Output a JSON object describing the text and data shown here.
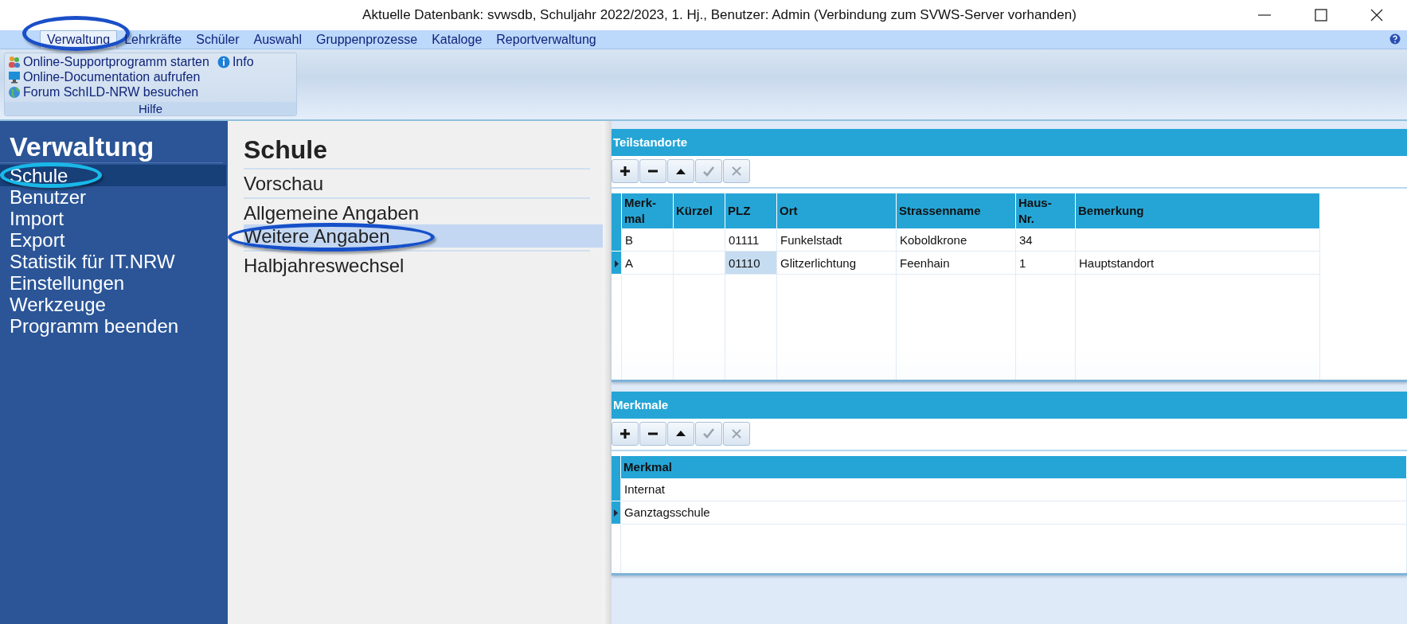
{
  "window": {
    "title": "Aktuelle Datenbank: svwsdb, Schuljahr 2022/2023, 1. Hj., Benutzer: Admin (Verbindung zum SVWS-Server vorhanden)"
  },
  "menu": [
    {
      "label": "Verwaltung",
      "selected": true,
      "circled": true
    },
    {
      "label": "Lehrkräfte",
      "selected": false
    },
    {
      "label": "Schüler",
      "selected": false
    },
    {
      "label": "Auswahl",
      "selected": false
    },
    {
      "label": "Gruppenprozesse",
      "selected": false
    },
    {
      "label": "Kataloge",
      "selected": false
    },
    {
      "label": "Reportverwaltung",
      "selected": false
    }
  ],
  "ribbon": {
    "group_label": "Hilfe",
    "items": [
      {
        "kind": "people",
        "label": "Online-Supportprogramm starten"
      },
      {
        "kind": "monitor",
        "label": "Online-Documentation aufrufen"
      },
      {
        "kind": "globe",
        "label": "Forum SchILD-NRW besuchen"
      }
    ],
    "info": {
      "kind": "info",
      "label": "Info"
    }
  },
  "sidebar": {
    "title": "Verwaltung",
    "items": [
      {
        "label": "Schule",
        "selected": true,
        "circled": true
      },
      {
        "label": "Benutzer",
        "selected": false
      },
      {
        "label": "Import",
        "selected": false
      },
      {
        "label": "Export",
        "selected": false
      },
      {
        "label": "Statistik für IT.NRW",
        "selected": false
      },
      {
        "label": "Einstellungen",
        "selected": false
      },
      {
        "label": "Werkzeuge",
        "selected": false
      },
      {
        "label": "Programm beenden",
        "selected": false
      }
    ]
  },
  "section": {
    "title": "Schule",
    "groups": [
      {
        "items": [
          {
            "label": "Vorschau",
            "selected": false
          }
        ]
      },
      {
        "items": [
          {
            "label": "Allgemeine Angaben",
            "selected": false
          },
          {
            "label": "Weitere Angaben",
            "selected": true,
            "circled": true
          }
        ]
      },
      {
        "items": [
          {
            "label": "Halbjahreswechsel",
            "selected": false
          }
        ]
      }
    ]
  },
  "panels": [
    {
      "title": "Teilstandorte",
      "tools": [
        {
          "kind": "add",
          "disabled": false
        },
        {
          "kind": "remove",
          "disabled": false
        },
        {
          "kind": "up",
          "disabled": false
        },
        {
          "kind": "save",
          "disabled": true
        },
        {
          "kind": "cancel",
          "disabled": true
        }
      ],
      "columns": [
        "Merk-\nmal",
        "Kürzel",
        "PLZ",
        "Ort",
        "Strassenname",
        "Haus-\nNr.",
        "Bemerkung"
      ],
      "rows": [
        {
          "current": false,
          "cells": [
            {
              "text": "B",
              "selected": false
            },
            {
              "selected": false
            },
            {
              "text": "01111",
              "selected": false
            },
            {
              "text": "Funkelstadt",
              "selected": false
            },
            {
              "text": "Koboldkrone",
              "selected": false
            },
            {
              "text": "34",
              "selected": false
            },
            {
              "selected": false
            }
          ]
        },
        {
          "current": true,
          "cells": [
            {
              "text": "A",
              "selected": false
            },
            {
              "selected": false
            },
            {
              "text": "01110",
              "selected": true
            },
            {
              "text": "Glitzerlichtung",
              "selected": false
            },
            {
              "text": "Feenhain",
              "selected": false
            },
            {
              "text": "1",
              "selected": false
            },
            {
              "text": "Hauptstandort",
              "selected": false
            }
          ]
        }
      ]
    },
    {
      "title": "Merkmale",
      "tools": [
        {
          "kind": "add",
          "disabled": false
        },
        {
          "kind": "remove",
          "disabled": false
        },
        {
          "kind": "up",
          "disabled": false
        },
        {
          "kind": "save",
          "disabled": true
        },
        {
          "kind": "cancel",
          "disabled": true
        }
      ],
      "columns": [
        "Merkmal"
      ],
      "rows": [
        {
          "current": false,
          "cells": [
            {
              "text": "Internat",
              "selected": false
            }
          ]
        },
        {
          "current": true,
          "cells": [
            {
              "text": "Ganztagsschule",
              "selected": false
            }
          ]
        }
      ]
    }
  ]
}
